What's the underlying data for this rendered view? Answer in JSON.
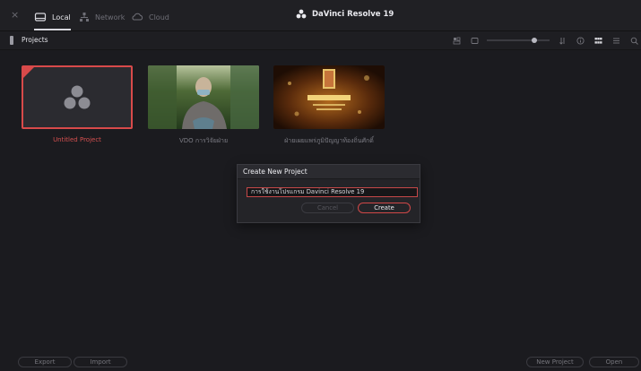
{
  "titlebar": {
    "close_glyph": "×",
    "tabs": [
      {
        "label": "Local",
        "icon": "local-drive-icon",
        "active": true
      },
      {
        "label": "Network",
        "icon": "network-icon",
        "active": false
      },
      {
        "label": "Cloud",
        "icon": "cloud-icon",
        "active": false
      }
    ],
    "app_title": "DaVinci Resolve 19"
  },
  "subbar": {
    "title": "Projects",
    "toolbar_icons": [
      "grid-view-icon",
      "list-view-icon",
      "sort-icon",
      "info-icon",
      "thumbnail-grid-icon",
      "list-icon",
      "search-icon"
    ]
  },
  "projects": [
    {
      "label": "Untitled Project",
      "selected": true
    },
    {
      "label": "VDO การวิจัยฝ่าย",
      "selected": false
    },
    {
      "label": "ฝ่ายเผยแพร่ภูมิปัญญาท้องถิ่นศักดิ์",
      "selected": false
    }
  ],
  "dialog": {
    "title": "Create New Project",
    "input_value": "การใช้งานโปรแกรม Davinci Resolve 19",
    "cancel_label": "Cancel",
    "create_label": "Create"
  },
  "footer": {
    "export_label": "Export",
    "import_label": "Import",
    "new_project_label": "New Project",
    "open_label": "Open"
  },
  "colors": {
    "accent": "#d84a4a",
    "background": "#1b1b1f"
  }
}
